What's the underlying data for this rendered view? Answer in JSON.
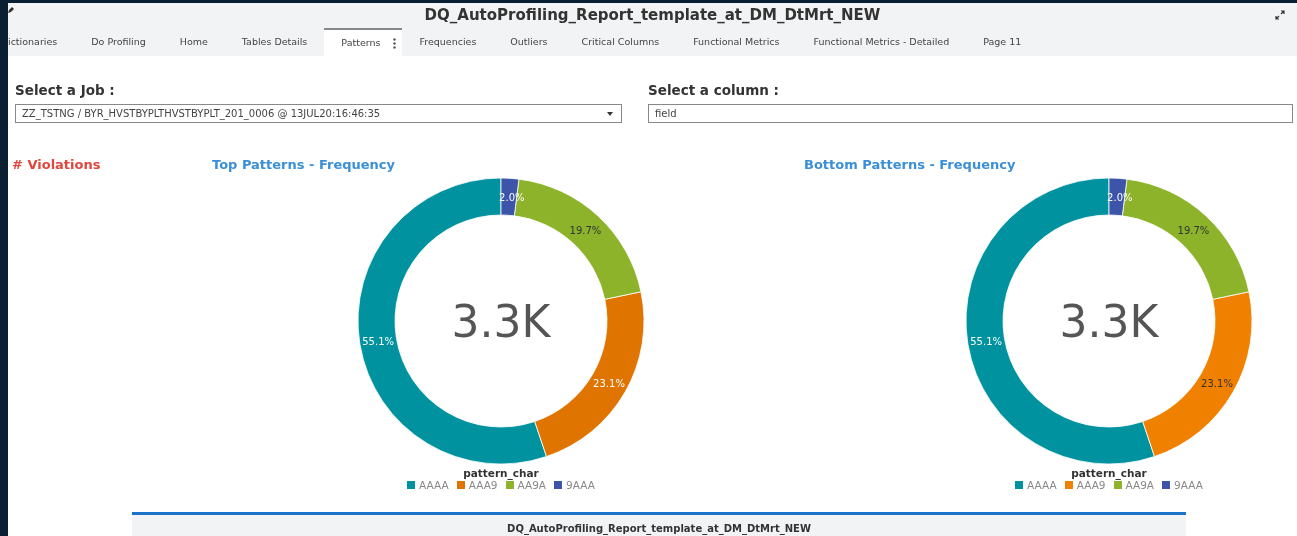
{
  "window": {
    "title": "DQ_AutoProfiling_Report_template_at_DM_DtMrt_NEW"
  },
  "tabs": [
    {
      "label": "ictionaries",
      "selected": false
    },
    {
      "label": "Do Profiling",
      "selected": false
    },
    {
      "label": "Home",
      "selected": false
    },
    {
      "label": "Tables Details",
      "selected": false
    },
    {
      "label": "Patterns",
      "selected": true
    },
    {
      "label": "Frequencies",
      "selected": false
    },
    {
      "label": "Outliers",
      "selected": false
    },
    {
      "label": "Critical Columns",
      "selected": false
    },
    {
      "label": "Functional Metrics",
      "selected": false
    },
    {
      "label": "Functional Metrics - Detailed",
      "selected": false
    },
    {
      "label": "Page 11",
      "selected": false
    }
  ],
  "filters": [
    {
      "kind": "dropdown",
      "label": "Select a Job :",
      "value": "ZZ_TSTNG / BYR_HVSTBYPLTHVSTBYPLT_201_0006 @ 13JUL20:16:46:35"
    },
    {
      "kind": "text",
      "label": "Select a column :",
      "value": "field"
    }
  ],
  "violations": {
    "title": "# Violations"
  },
  "charts": [
    {
      "title": "Top Patterns - Frequency",
      "center_label": "3.3K",
      "slices": [
        {
          "color": "#00929f"
        },
        {
          "color": "#e07400"
        },
        {
          "color": "#8cb32a"
        },
        {
          "color": "#3d55a8"
        }
      ],
      "chart_data": {
        "type": "donut",
        "categories": [
          "AAAA",
          "AAA9",
          "AA9A",
          "9AAA"
        ],
        "series": [
          {
            "name": "pattern_char",
            "values": [
              55.1,
              23.1,
              19.7,
              2.0
            ]
          }
        ],
        "value_labels": [
          "55.1%",
          "23.1%",
          "19.7%",
          "2.0%"
        ]
      }
    },
    {
      "title": "Bottom Patterns - Frequency",
      "center_label": "3.3K",
      "slices": [
        {
          "color": "#00929f"
        },
        {
          "color": "#f08000"
        },
        {
          "color": "#8cb32a"
        },
        {
          "color": "#3d55a8"
        }
      ],
      "chart_data": {
        "type": "donut",
        "categories": [
          "AAAA",
          "AAA9",
          "AA9A",
          "9AAA"
        ],
        "series": [
          {
            "name": "pattern_char",
            "values": [
              55.1,
              23.1,
              19.7,
              2.0
            ]
          }
        ],
        "value_labels": [
          "55.1%",
          "23.1%",
          "19.7%",
          "2.0%"
        ]
      }
    }
  ],
  "background_window": {
    "title": "DQ_AutoProfiling_Report_template_at_DM_DtMrt_NEW"
  }
}
